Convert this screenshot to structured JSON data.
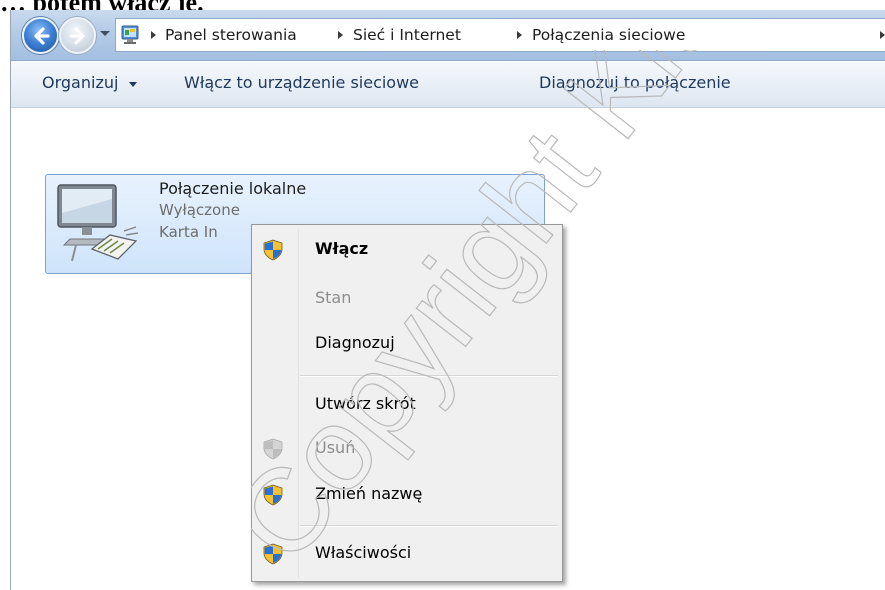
{
  "caption": "… potem włącz je.",
  "nav": {
    "back_icon": "back-arrow-icon",
    "forward_icon": "forward-arrow-icon",
    "recent_icon": "chevron-down-icon"
  },
  "breadcrumb": {
    "icon": "control-panel-icon",
    "items": [
      "Panel sterowania",
      "Sieć i Internet",
      "Połączenia sieciowe"
    ]
  },
  "toolbar": {
    "organize": "Organizuj",
    "enable_device": "Włącz to urządzenie sieciowe",
    "diagnose": "Diagnozuj to połączenie"
  },
  "connection": {
    "icon": "network-adapter-icon",
    "name": "Połączenie lokalne",
    "status": "Wyłączone",
    "adapter": "Karta In"
  },
  "context_menu": {
    "items": [
      {
        "label": "Włącz",
        "shield": "uac-shield-icon",
        "bold": true
      },
      {
        "label": "Stan",
        "disabled": true
      },
      {
        "label": "Diagnozuj"
      },
      {
        "label": "Utwórz skrót"
      },
      {
        "label": "Usuń",
        "shield": "uac-shield-icon",
        "disabled": true
      },
      {
        "label": "Zmień nazwę",
        "shield": "uac-shield-icon"
      },
      {
        "label": "Właściwości",
        "shield": "uac-shield-icon"
      }
    ]
  },
  "watermark": "Copyright Kluczewski",
  "colors": {
    "selection_fill": "#cfe4fb",
    "selection_border": "#7da2ce",
    "address_bar": "#b3cbe6",
    "menu_bg": "#f0f0f0",
    "disabled_text": "#8d8d8d"
  }
}
